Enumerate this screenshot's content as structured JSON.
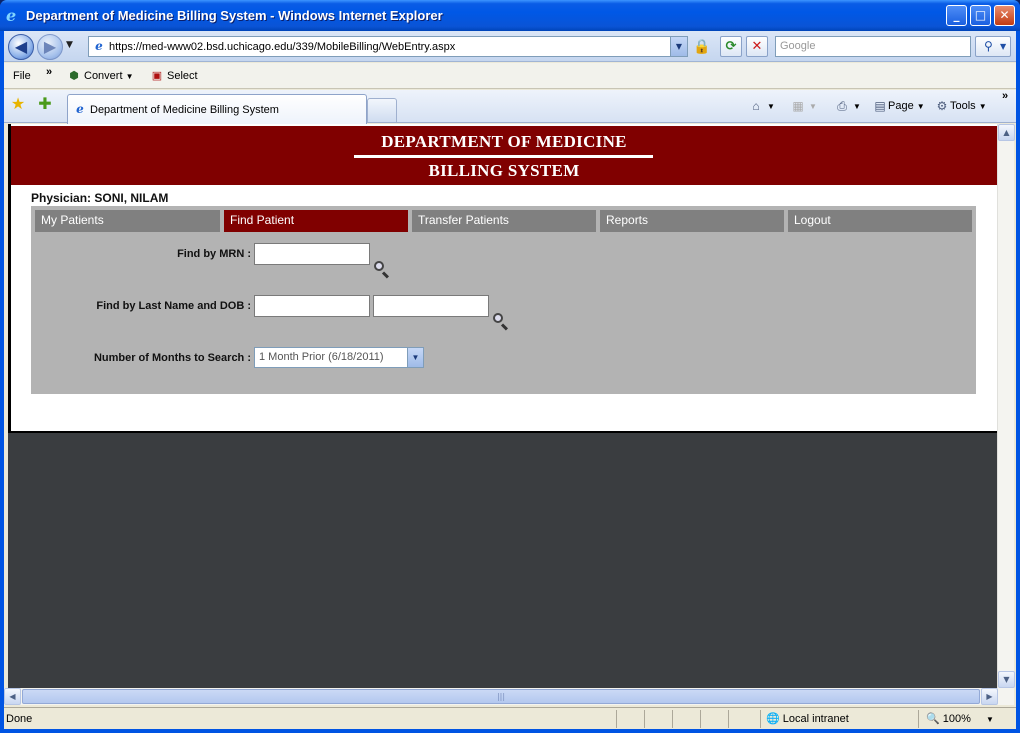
{
  "window": {
    "title": "Department of Medicine Billing System - Windows Internet Explorer",
    "minimize": "_",
    "maximize": "□",
    "close": "✕"
  },
  "addressbar": {
    "url": "https://med-www02.bsd.uchicago.edu/339/MobileBilling/WebEntry.aspx",
    "search_placeholder": "Google"
  },
  "menubar": {
    "file": "File",
    "chevron": "»",
    "convert": "Convert",
    "select": "Select"
  },
  "tabs": {
    "active_tab": "Department of Medicine Billing System"
  },
  "commandbar": {
    "page": "Page",
    "tools": "Tools",
    "chevron": "»"
  },
  "header": {
    "line1": "DEPARTMENT OF MEDICINE",
    "line2": "BILLING SYSTEM",
    "brand_color": "#800000"
  },
  "physician": "Physician: SONI, NILAM",
  "nav": [
    {
      "label": "My Patients",
      "active": false
    },
    {
      "label": "Find Patient",
      "active": true
    },
    {
      "label": "Transfer Patients",
      "active": false
    },
    {
      "label": "Reports",
      "active": false
    },
    {
      "label": "Logout",
      "active": false
    }
  ],
  "form": {
    "mrn_label": "Find by MRN :",
    "mrn_value": "",
    "name_dob_label": "Find by Last Name and DOB :",
    "lastname_value": "",
    "dob_value": "",
    "months_label": "Number of Months to Search :",
    "months_selected": "1 Month Prior (6/18/2011)"
  },
  "statusbar": {
    "status": "Done",
    "zone": "Local intranet",
    "zoom": "100%"
  }
}
